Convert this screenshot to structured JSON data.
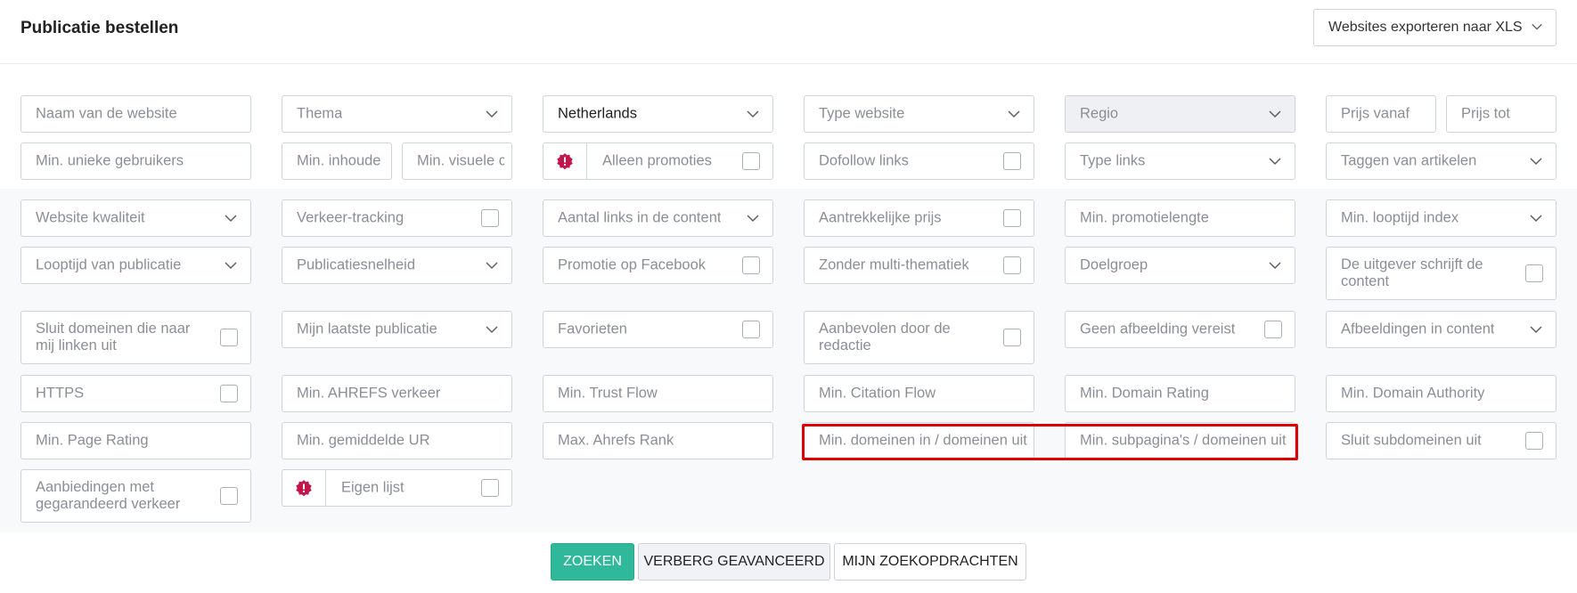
{
  "header": {
    "title": "Publicatie bestellen",
    "export_label": "Websites exporteren naar XLS"
  },
  "filters": {
    "website_name": "Naam van de website",
    "theme": "Thema",
    "country": "Netherlands",
    "website_type": "Type website",
    "region": "Regio",
    "price_from": "Prijs vanaf",
    "price_to": "Prijs tot",
    "min_unique_users": "Min. unieke gebruikers",
    "min_content": "Min. inhoude",
    "min_visual": "Min. visuele c",
    "only_promotions": "Alleen promoties",
    "dofollow_links": "Dofollow links",
    "link_type": "Type links",
    "article_tagging": "Taggen van artikelen",
    "website_quality": "Website kwaliteit",
    "traffic_tracking": "Verkeer-tracking",
    "links_in_content": "Aantal links in de content",
    "attractive_price": "Aantrekkelijke prijs",
    "min_promo_length": "Min. promotielengte",
    "min_index_duration": "Min. looptijd index",
    "publication_duration": "Looptijd van publicatie",
    "publication_speed": "Publicatiesnelheid",
    "facebook_promo": "Promotie op Facebook",
    "no_multi_theme": "Zonder multi-thematiek",
    "target_group": "Doelgroep",
    "publisher_writes": "De uitgever schrijft de content",
    "exclude_linking_domains": "Sluit domeinen die naar mij linken uit",
    "my_last_publication": "Mijn laatste publicatie",
    "favorites": "Favorieten",
    "recommended": "Aanbevolen door de redactie",
    "no_image_required": "Geen afbeelding vereist",
    "images_in_content": "Afbeeldingen in content",
    "https": "HTTPS",
    "min_ahrefs_traffic": "Min. AHREFS verkeer",
    "min_trust_flow": "Min. Trust Flow",
    "min_citation_flow": "Min. Citation Flow",
    "min_domain_rating": "Min. Domain Rating",
    "min_domain_authority": "Min. Domain Authority",
    "min_page_rating": "Min. Page Rating",
    "min_avg_ur": "Min. gemiddelde UR",
    "max_ahrefs_rank": "Max. Ahrefs Rank",
    "min_domains_in_out": "Min. domeinen in / domeinen uit",
    "min_subpages_out": "Min. subpagina's / domeinen uit",
    "exclude_subdomains": "Sluit subdomeinen uit",
    "guaranteed_traffic": "Aanbiedingen met gegarandeerd verkeer",
    "own_list": "Eigen lijst"
  },
  "actions": {
    "search": "ZOEKEN",
    "hide_advanced": "VERBERG GEAVANCEERD",
    "my_searches": "MIJN ZOEKOPDRACHTEN"
  },
  "colors": {
    "accent": "#30b89a",
    "highlight": "#e00000",
    "promo_icon": "#c4154a"
  }
}
